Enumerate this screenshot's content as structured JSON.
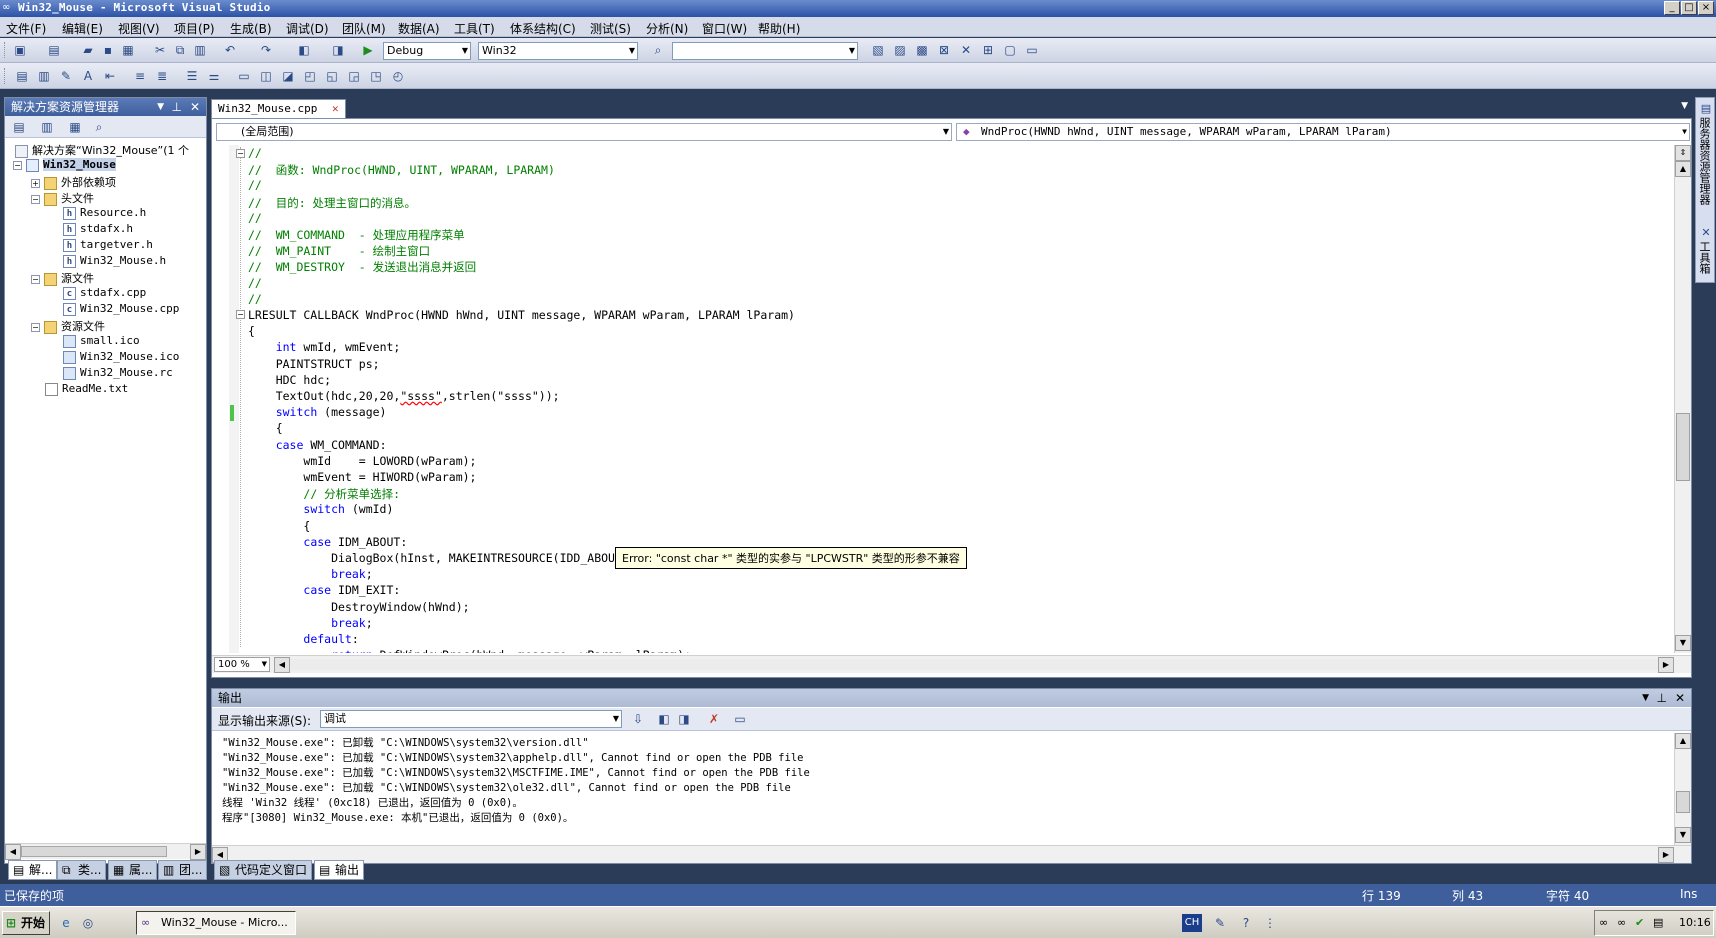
{
  "window": {
    "title": "Win32_Mouse - Microsoft Visual Studio",
    "controls": [
      "_",
      "□",
      "×"
    ]
  },
  "menu": [
    "文件(F)",
    "编辑(E)",
    "视图(V)",
    "项目(P)",
    "生成(B)",
    "调试(D)",
    "团队(M)",
    "数据(A)",
    "工具(T)",
    "体系结构(C)",
    "测试(S)",
    "分析(N)",
    "窗口(W)",
    "帮助(H)"
  ],
  "toolbar": {
    "config": "Debug",
    "platform": "Win32",
    "find_value": ""
  },
  "solution_explorer": {
    "title": "解决方案资源管理器",
    "items": [
      {
        "label": "解决方案“Win32_Mouse”(1 个",
        "icon": "solution-icon"
      },
      {
        "label": "Win32_Mouse",
        "icon": "project-icon"
      },
      {
        "label": "外部依赖项",
        "icon": "folder-icon"
      },
      {
        "label": "头文件",
        "icon": "folder-icon"
      },
      {
        "label": "Resource.h",
        "icon": "header-file-icon"
      },
      {
        "label": "stdafx.h",
        "icon": "header-file-icon"
      },
      {
        "label": "targetver.h",
        "icon": "header-file-icon"
      },
      {
        "label": "Win32_Mouse.h",
        "icon": "header-file-icon"
      },
      {
        "label": "源文件",
        "icon": "folder-icon"
      },
      {
        "label": "stdafx.cpp",
        "icon": "cpp-file-icon"
      },
      {
        "label": "Win32_Mouse.cpp",
        "icon": "cpp-file-icon"
      },
      {
        "label": "资源文件",
        "icon": "folder-icon"
      },
      {
        "label": "small.ico",
        "icon": "resource-file-icon"
      },
      {
        "label": "Win32_Mouse.ico",
        "icon": "resource-file-icon"
      },
      {
        "label": "Win32_Mouse.rc",
        "icon": "resource-file-icon"
      },
      {
        "label": "ReadMe.txt",
        "icon": "text-file-icon"
      }
    ]
  },
  "editor": {
    "tab": "Win32_Mouse.cpp",
    "scope": "(全局范围)",
    "member": "WndProc(HWND hWnd, UINT message, WPARAM wParam, LPARAM lParam)",
    "zoom": "100 %",
    "code": [
      {
        "indent": "",
        "parts": [
          {
            "t": "//",
            "c": "cm"
          }
        ]
      },
      {
        "indent": "",
        "parts": [
          {
            "t": "//  函数: WndProc(HWND, UINT, WPARAM, LPARAM)",
            "c": "cm"
          }
        ]
      },
      {
        "indent": "",
        "parts": [
          {
            "t": "//",
            "c": "cm"
          }
        ]
      },
      {
        "indent": "",
        "parts": [
          {
            "t": "//  目的: 处理主窗口的消息。",
            "c": "cm"
          }
        ]
      },
      {
        "indent": "",
        "parts": [
          {
            "t": "//",
            "c": "cm"
          }
        ]
      },
      {
        "indent": "",
        "parts": [
          {
            "t": "//  WM_COMMAND  - 处理应用程序菜单",
            "c": "cm"
          }
        ]
      },
      {
        "indent": "",
        "parts": [
          {
            "t": "//  WM_PAINT    - 绘制主窗口",
            "c": "cm"
          }
        ]
      },
      {
        "indent": "",
        "parts": [
          {
            "t": "//  WM_DESTROY  - 发送退出消息并返回",
            "c": "cm"
          }
        ]
      },
      {
        "indent": "",
        "parts": [
          {
            "t": "//",
            "c": "cm"
          }
        ]
      },
      {
        "indent": "",
        "parts": [
          {
            "t": "//",
            "c": "cm"
          }
        ]
      },
      {
        "indent": "",
        "parts": [
          {
            "t": "LRESULT CALLBACK WndProc(HWND hWnd, UINT message, WPARAM wParam, LPARAM lParam)",
            "c": ""
          }
        ]
      },
      {
        "indent": "",
        "parts": [
          {
            "t": "{",
            "c": ""
          }
        ]
      },
      {
        "indent": "    ",
        "parts": [
          {
            "t": "int",
            "c": "kw"
          },
          {
            "t": " wmId, wmEvent;",
            "c": ""
          }
        ]
      },
      {
        "indent": "    ",
        "parts": [
          {
            "t": "PAINTSTRUCT ps;",
            "c": ""
          }
        ]
      },
      {
        "indent": "    ",
        "parts": [
          {
            "t": "HDC hdc;",
            "c": ""
          }
        ]
      },
      {
        "indent": "    ",
        "parts": [
          {
            "t": "TextOut(hdc,20,20,",
            "c": ""
          },
          {
            "t": "\"ssss\"",
            "c": "squig"
          },
          {
            "t": ",strlen(\"ssss\"));",
            "c": ""
          }
        ]
      },
      {
        "indent": "    ",
        "parts": [
          {
            "t": "switch",
            "c": "kw"
          },
          {
            "t": " (message)",
            "c": ""
          }
        ]
      },
      {
        "indent": "    ",
        "parts": [
          {
            "t": "{",
            "c": ""
          }
        ]
      },
      {
        "indent": "    ",
        "parts": [
          {
            "t": "case",
            "c": "kw"
          },
          {
            "t": " WM_COMMAND:",
            "c": ""
          }
        ]
      },
      {
        "indent": "        ",
        "parts": [
          {
            "t": "wmId    = LOWORD(wParam);",
            "c": ""
          }
        ]
      },
      {
        "indent": "        ",
        "parts": [
          {
            "t": "wmEvent = HIWORD(wParam);",
            "c": ""
          }
        ]
      },
      {
        "indent": "        ",
        "parts": [
          {
            "t": "// 分析菜单选择:",
            "c": "cm"
          }
        ]
      },
      {
        "indent": "        ",
        "parts": [
          {
            "t": "switch",
            "c": "kw"
          },
          {
            "t": " (wmId)",
            "c": ""
          }
        ]
      },
      {
        "indent": "        ",
        "parts": [
          {
            "t": "{",
            "c": ""
          }
        ]
      },
      {
        "indent": "        ",
        "parts": [
          {
            "t": "case",
            "c": "kw"
          },
          {
            "t": " IDM_ABOUT:",
            "c": ""
          }
        ]
      },
      {
        "indent": "            ",
        "parts": [
          {
            "t": "DialogBox(hInst, MAKEINTRESOURCE(IDD_ABOUTBOX), hWnd, About);",
            "c": ""
          }
        ]
      },
      {
        "indent": "            ",
        "parts": [
          {
            "t": "break",
            "c": "kw"
          },
          {
            "t": ";",
            "c": ""
          }
        ]
      },
      {
        "indent": "        ",
        "parts": [
          {
            "t": "case",
            "c": "kw"
          },
          {
            "t": " IDM_EXIT:",
            "c": ""
          }
        ]
      },
      {
        "indent": "            ",
        "parts": [
          {
            "t": "DestroyWindow(hWnd);",
            "c": ""
          }
        ]
      },
      {
        "indent": "            ",
        "parts": [
          {
            "t": "break",
            "c": "kw"
          },
          {
            "t": ";",
            "c": ""
          }
        ]
      },
      {
        "indent": "        ",
        "parts": [
          {
            "t": "default",
            "c": "kw"
          },
          {
            "t": ":",
            "c": ""
          }
        ]
      },
      {
        "indent": "            ",
        "parts": [
          {
            "t": "return",
            "c": "kw"
          },
          {
            "t": " DefWindowProc(hWnd, message, wParam, lParam);",
            "c": ""
          }
        ]
      }
    ],
    "error_tooltip": "Error: \"const char *\" 类型的实参与 \"LPCWSTR\" 类型的形参不兼容"
  },
  "output": {
    "title": "输出",
    "source_label": "显示输出来源(S):",
    "source_value": "调试",
    "lines": [
      "\"Win32_Mouse.exe\": 已卸载 \"C:\\WINDOWS\\system32\\version.dll\"",
      "\"Win32_Mouse.exe\": 已加载 \"C:\\WINDOWS\\system32\\apphelp.dll\", Cannot find or open the PDB file",
      "\"Win32_Mouse.exe\": 已加载 \"C:\\WINDOWS\\system32\\MSCTFIME.IME\", Cannot find or open the PDB file",
      "\"Win32_Mouse.exe\": 已加载 \"C:\\WINDOWS\\system32\\ole32.dll\", Cannot find or open the PDB file",
      "线程 'Win32 线程' (0xc18) 已退出，返回值为 0 (0x0)。",
      "程序\"[3080] Win32_Mouse.exe: 本机\"已退出，返回值为 0 (0x0)。"
    ]
  },
  "right_sidebar": [
    "服务器资源管理器",
    "工具箱"
  ],
  "bottom_tabs": [
    "解...",
    "类...",
    "属...",
    "团...",
    "代码定义窗口",
    "输出"
  ],
  "status": {
    "message": "已保存的项",
    "line": "行 139",
    "col": "列 43",
    "char": "字符 40",
    "mode": "Ins"
  },
  "taskbar": {
    "start": "开始",
    "app": "Win32_Mouse - Micro...",
    "ime": "CH",
    "time": "10:16"
  }
}
